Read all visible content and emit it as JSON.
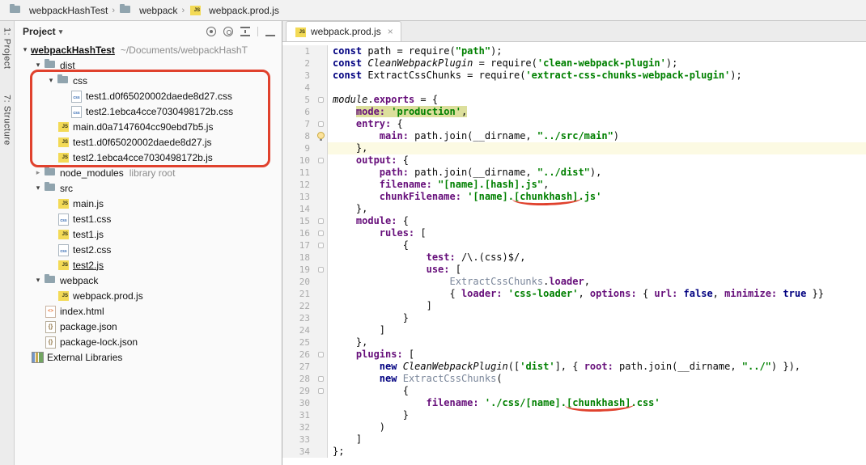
{
  "glyphs": {
    "crumb_sep": "›",
    "caret_down": "▾",
    "close": "×",
    "tree_open": "▾",
    "tree_closed": "▸"
  },
  "colors": {
    "annotation": "#E0412D",
    "token_highlight": "#DCDF9C",
    "current_line": "#FCFAE3"
  },
  "breadcrumbs": {
    "items": [
      {
        "label": "webpackHashTest",
        "icon": "folder"
      },
      {
        "label": "webpack",
        "icon": "folder"
      },
      {
        "label": "webpack.prod.js",
        "icon": "js"
      }
    ]
  },
  "tool_strip": {
    "project": "1: Project",
    "structure": "7: Structure"
  },
  "project_panel": {
    "title": "Project",
    "tree": [
      {
        "depth": 0,
        "chevron": "open",
        "icon": "none",
        "label": "webpackHashTest",
        "suffix": "~/Documents/webpackHashT",
        "bold": true,
        "underline": true
      },
      {
        "depth": 1,
        "chevron": "open",
        "icon": "folder",
        "label": "dist"
      },
      {
        "depth": 2,
        "chevron": "open",
        "icon": "folder",
        "label": "css"
      },
      {
        "depth": 3,
        "chevron": "none",
        "icon": "css",
        "label": "test1.d0f65020002daede8d27.css"
      },
      {
        "depth": 3,
        "chevron": "none",
        "icon": "css",
        "label": "test2.1ebca4cce7030498172b.css"
      },
      {
        "depth": 2,
        "chevron": "none",
        "icon": "js",
        "label": "main.d0a7147604cc90ebd7b5.js"
      },
      {
        "depth": 2,
        "chevron": "none",
        "icon": "js",
        "label": "test1.d0f65020002daede8d27.js"
      },
      {
        "depth": 2,
        "chevron": "none",
        "icon": "js",
        "label": "test2.1ebca4cce7030498172b.js"
      },
      {
        "depth": 1,
        "chevron": "closed",
        "icon": "folder",
        "label": "node_modules",
        "suffix": "library root"
      },
      {
        "depth": 1,
        "chevron": "open",
        "icon": "folder",
        "label": "src"
      },
      {
        "depth": 2,
        "chevron": "none",
        "icon": "js",
        "label": "main.js"
      },
      {
        "depth": 2,
        "chevron": "none",
        "icon": "css",
        "label": "test1.css"
      },
      {
        "depth": 2,
        "chevron": "none",
        "icon": "js",
        "label": "test1.js"
      },
      {
        "depth": 2,
        "chevron": "none",
        "icon": "css",
        "label": "test2.css"
      },
      {
        "depth": 2,
        "chevron": "none",
        "icon": "js",
        "label": "test2.js",
        "underline": true
      },
      {
        "depth": 1,
        "chevron": "open",
        "icon": "folder",
        "label": "webpack"
      },
      {
        "depth": 2,
        "chevron": "none",
        "icon": "js",
        "label": "webpack.prod.js"
      },
      {
        "depth": 1,
        "chevron": "none",
        "icon": "html",
        "label": "index.html"
      },
      {
        "depth": 1,
        "chevron": "none",
        "icon": "json",
        "label": "package.json"
      },
      {
        "depth": 1,
        "chevron": "none",
        "icon": "json",
        "label": "package-lock.json"
      },
      {
        "depth": 0,
        "chevron": "none",
        "icon": "lib",
        "label": "External Libraries"
      }
    ]
  },
  "editor": {
    "tab": "webpack.prod.js",
    "lines": [
      {
        "n": 1,
        "s": [
          [
            "kw",
            "const"
          ],
          [
            "p",
            " path = require("
          ],
          [
            "s",
            "\"path\""
          ],
          [
            "p",
            ");"
          ]
        ]
      },
      {
        "n": 2,
        "s": [
          [
            "kw",
            "const"
          ],
          [
            "p",
            " "
          ],
          [
            "it",
            "CleanWebpackPlugin"
          ],
          [
            "p",
            " = require("
          ],
          [
            "s",
            "'clean-webpack-plugin'"
          ],
          [
            "p",
            ");"
          ]
        ]
      },
      {
        "n": 3,
        "s": [
          [
            "kw",
            "const"
          ],
          [
            "p",
            " ExtractCssChunks = require("
          ],
          [
            "s",
            "'extract-css-chunks-webpack-plugin'"
          ],
          [
            "p",
            ");"
          ]
        ]
      },
      {
        "n": 4,
        "s": []
      },
      {
        "n": 5,
        "fold": true,
        "s": [
          [
            "it",
            "module"
          ],
          [
            "p",
            "."
          ],
          [
            "pr",
            "exports"
          ],
          [
            "p",
            " = {"
          ]
        ]
      },
      {
        "n": 6,
        "s": [
          [
            "p",
            "    "
          ],
          [
            "pr hl",
            "mode: "
          ],
          [
            "s hl",
            "'production'"
          ],
          [
            "p hl",
            ","
          ]
        ]
      },
      {
        "n": 7,
        "fold": true,
        "s": [
          [
            "p",
            "    "
          ],
          [
            "pr",
            "entry:"
          ],
          [
            "p",
            " {"
          ]
        ]
      },
      {
        "n": 8,
        "bulb": true,
        "s": [
          [
            "p",
            "        "
          ],
          [
            "pr",
            "main:"
          ],
          [
            "p",
            " path.join(__dirname, "
          ],
          [
            "s",
            "\"../src/main\""
          ],
          [
            "p",
            ")"
          ]
        ]
      },
      {
        "n": 9,
        "cur": true,
        "s": [
          [
            "p",
            "    },"
          ]
        ]
      },
      {
        "n": 10,
        "fold": true,
        "s": [
          [
            "p",
            "    "
          ],
          [
            "pr",
            "output:"
          ],
          [
            "p",
            " {"
          ]
        ]
      },
      {
        "n": 11,
        "s": [
          [
            "p",
            "        "
          ],
          [
            "pr",
            "path:"
          ],
          [
            "p",
            " path.join(__dirname, "
          ],
          [
            "s",
            "\"../dist\""
          ],
          [
            "p",
            "),"
          ]
        ]
      },
      {
        "n": 12,
        "s": [
          [
            "p",
            "        "
          ],
          [
            "pr",
            "filename:"
          ],
          [
            "p",
            " "
          ],
          [
            "s",
            "\"[name].[hash].js\""
          ],
          [
            "p",
            ","
          ]
        ]
      },
      {
        "n": 13,
        "s": [
          [
            "p",
            "        "
          ],
          [
            "pr",
            "chunkFilename:"
          ],
          [
            "p",
            " "
          ],
          [
            "s",
            "'[name]."
          ],
          [
            "s rl",
            "[chunkhash]"
          ],
          [
            "s",
            ".js'"
          ]
        ]
      },
      {
        "n": 14,
        "s": [
          [
            "p",
            "    },"
          ]
        ]
      },
      {
        "n": 15,
        "fold": true,
        "s": [
          [
            "p",
            "    "
          ],
          [
            "pr",
            "module:"
          ],
          [
            "p",
            " {"
          ]
        ]
      },
      {
        "n": 16,
        "fold": true,
        "s": [
          [
            "p",
            "        "
          ],
          [
            "pr",
            "rules:"
          ],
          [
            "p",
            " ["
          ]
        ]
      },
      {
        "n": 17,
        "fold": true,
        "s": [
          [
            "p",
            "            {"
          ]
        ]
      },
      {
        "n": 18,
        "s": [
          [
            "p",
            "                "
          ],
          [
            "pr",
            "test:"
          ],
          [
            "p",
            " /\\.(css)$/,"
          ]
        ]
      },
      {
        "n": 19,
        "fold": true,
        "s": [
          [
            "p",
            "                "
          ],
          [
            "pr",
            "use:"
          ],
          [
            "p",
            " ["
          ]
        ]
      },
      {
        "n": 20,
        "s": [
          [
            "p",
            "                    "
          ],
          [
            "rf",
            "ExtractCssChunks"
          ],
          [
            "p",
            "."
          ],
          [
            "pr",
            "loader"
          ],
          [
            "p",
            ","
          ]
        ]
      },
      {
        "n": 21,
        "s": [
          [
            "p",
            "                    { "
          ],
          [
            "pr",
            "loader:"
          ],
          [
            "p",
            " "
          ],
          [
            "s",
            "'css-loader'"
          ],
          [
            "p",
            ", "
          ],
          [
            "pr",
            "options:"
          ],
          [
            "p",
            " { "
          ],
          [
            "pr",
            "url:"
          ],
          [
            "p",
            " "
          ],
          [
            "kw",
            "false"
          ],
          [
            "p",
            ", "
          ],
          [
            "pr",
            "minimize:"
          ],
          [
            "p",
            " "
          ],
          [
            "kw",
            "true"
          ],
          [
            "p",
            " }}"
          ]
        ]
      },
      {
        "n": 22,
        "s": [
          [
            "p",
            "                ]"
          ]
        ]
      },
      {
        "n": 23,
        "s": [
          [
            "p",
            "            }"
          ]
        ]
      },
      {
        "n": 24,
        "s": [
          [
            "p",
            "        ]"
          ]
        ]
      },
      {
        "n": 25,
        "s": [
          [
            "p",
            "    },"
          ]
        ]
      },
      {
        "n": 26,
        "fold": true,
        "s": [
          [
            "p",
            "    "
          ],
          [
            "pr",
            "plugins:"
          ],
          [
            "p",
            " ["
          ]
        ]
      },
      {
        "n": 27,
        "s": [
          [
            "p",
            "        "
          ],
          [
            "kw",
            "new"
          ],
          [
            "p",
            " "
          ],
          [
            "it",
            "CleanWebpackPlugin"
          ],
          [
            "p",
            "(["
          ],
          [
            "s",
            "'dist'"
          ],
          [
            "p",
            "], { "
          ],
          [
            "pr",
            "root:"
          ],
          [
            "p",
            " path.join(__dirname, "
          ],
          [
            "s",
            "\"../\""
          ],
          [
            "p",
            ") }),"
          ]
        ]
      },
      {
        "n": 28,
        "fold": true,
        "s": [
          [
            "p",
            "        "
          ],
          [
            "kw",
            "new"
          ],
          [
            "p",
            " "
          ],
          [
            "rf",
            "ExtractCssChunks"
          ],
          [
            "p",
            "("
          ]
        ]
      },
      {
        "n": 29,
        "fold": true,
        "s": [
          [
            "p",
            "            {"
          ]
        ]
      },
      {
        "n": 30,
        "s": [
          [
            "p",
            "                "
          ],
          [
            "pr",
            "filename:"
          ],
          [
            "p",
            " "
          ],
          [
            "s",
            "'./css/[name]."
          ],
          [
            "s rl",
            "[chunkhash]"
          ],
          [
            "s",
            ".css'"
          ]
        ]
      },
      {
        "n": 31,
        "s": [
          [
            "p",
            "            }"
          ]
        ]
      },
      {
        "n": 32,
        "s": [
          [
            "p",
            "        )"
          ]
        ]
      },
      {
        "n": 33,
        "s": [
          [
            "p",
            "    ]"
          ]
        ]
      },
      {
        "n": 34,
        "s": [
          [
            "p",
            "};"
          ]
        ]
      }
    ]
  }
}
